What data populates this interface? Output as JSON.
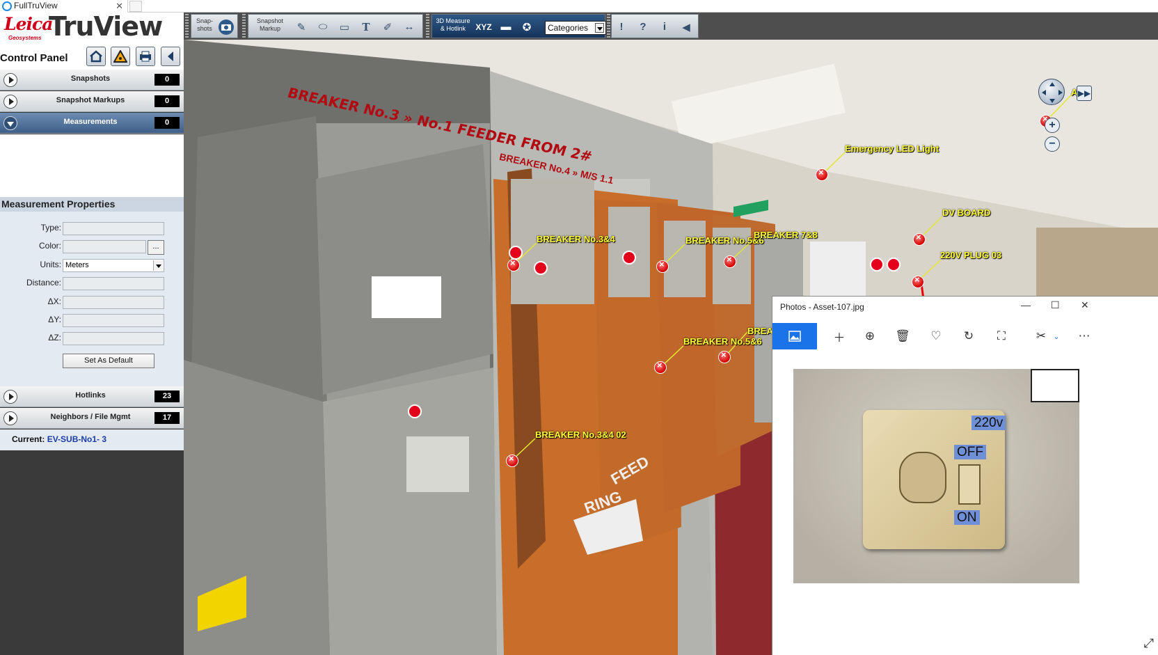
{
  "browser": {
    "tab_title": "FullTruView"
  },
  "app": {
    "brand": "Leica",
    "brand_sub": "Geosystems",
    "product": "TruView"
  },
  "control_panel": {
    "title": "Control Panel",
    "sections": {
      "snapshots": {
        "label": "Snapshots",
        "count": "0"
      },
      "snapshot_markups": {
        "label": "Snapshot Markups",
        "count": "0"
      },
      "measurements": {
        "label": "Measurements",
        "count": "0"
      },
      "hotlinks": {
        "label": "Hotlinks",
        "count": "23"
      },
      "neighbors": {
        "label": "Neighbors / File Mgmt",
        "count": "17"
      }
    },
    "measurement_properties": {
      "title": "Measurement Properties",
      "type_label": "Type:",
      "color_label": "Color:",
      "color_button": "...",
      "units_label": "Units:",
      "units_value": "Meters",
      "distance_label": "Distance:",
      "dx_label": "ΔX:",
      "dy_label": "ΔY:",
      "dz_label": "ΔZ:",
      "default_button": "Set As Default"
    },
    "current_label": "Current:",
    "current_value": "EV-SUB-No1- 3"
  },
  "toolbar": {
    "snapshots": "Snap-\nshots",
    "snapshot_markup": "Snapshot\nMarkup",
    "measure_hotlink": "3D Measure\n& Hotlink",
    "xyz": "XYZ",
    "categories": "Categories"
  },
  "scene": {
    "labels": {
      "breaker34": "BREAKER No.3&4",
      "breaker56_top": "BREAKER No.5&6",
      "breaker78": "BREAKER 7&8",
      "breaker56": "BREAKER No.5&6",
      "breaker_partial": "BREA",
      "breaker34_02": "BREAKER No.3&4 02",
      "emergency": "Emergency LED Light",
      "dv_board": "DV BOARD",
      "plug": "220V PLUG 03",
      "partial_right": "A"
    },
    "signs": {
      "main": "BREAKER No.3 » No.1 FEEDER FROM 2#",
      "second": "BREAKER No.4 » M/S 1.1",
      "ring": "RING",
      "feed": "FEED"
    }
  },
  "photos_window": {
    "title": "Photos - Asset-107.jpg",
    "stickers": {
      "voltage": "220v",
      "off": "OFF",
      "on": "ON"
    }
  },
  "colors": {
    "accent_blue": "#1a73e8",
    "label_yellow": "#ffff33",
    "hotlink_red": "#e4001b"
  }
}
